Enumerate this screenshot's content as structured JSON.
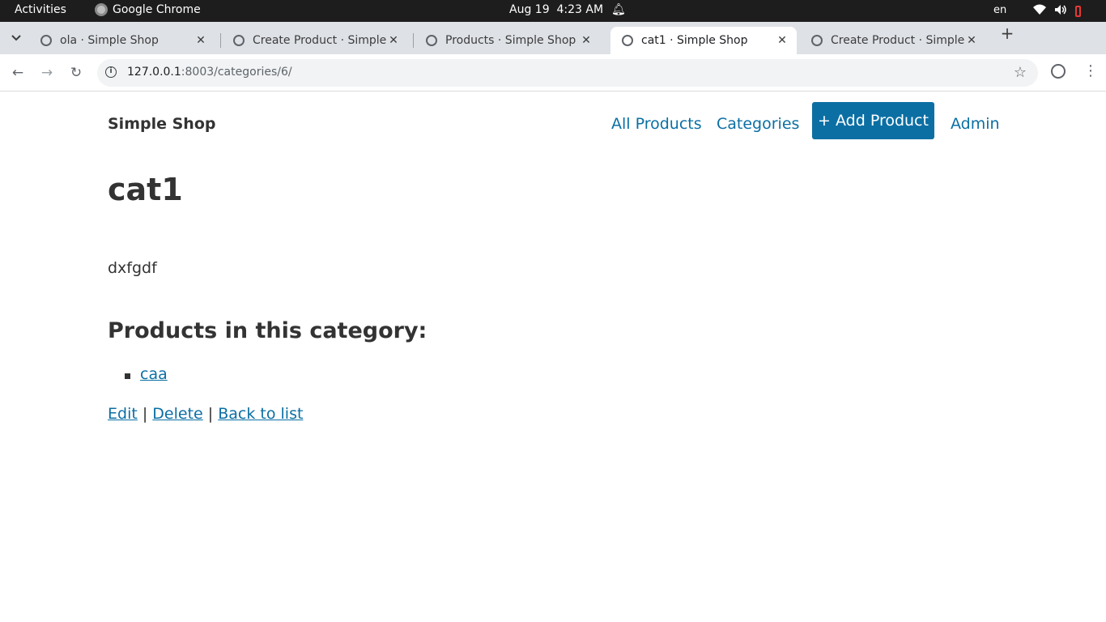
{
  "system": {
    "activities": "Activities",
    "app_name": "Google Chrome",
    "clock": "Aug 19  4:23 AM",
    "language": "en"
  },
  "tabs": [
    {
      "title": "ola · Simple Shop",
      "active": false
    },
    {
      "title": "Create Product · Simple Shop",
      "active": false
    },
    {
      "title": "Products · Simple Shop",
      "active": false
    },
    {
      "title": "cat1 · Simple Shop",
      "active": true
    },
    {
      "title": "Create Product · Simple Shop",
      "active": false
    }
  ],
  "address_bar": {
    "host": "127.0.0.1",
    "path": ":8003/categories/6/"
  },
  "site": {
    "brand": "Simple Shop",
    "nav": {
      "all_products": "All Products",
      "categories": "Categories",
      "add_product": "+ Add Product",
      "admin": "Admin"
    }
  },
  "category": {
    "name": "cat1",
    "description": "dxfgdf",
    "products_heading": "Products in this category:",
    "products": [
      "caa"
    ]
  },
  "actions": {
    "edit": "Edit",
    "delete": "Delete",
    "back": "Back to list",
    "separator": "|"
  },
  "colors": {
    "link": "#0b6fa4",
    "button_bg": "#0b6fa4",
    "text": "#333333"
  }
}
